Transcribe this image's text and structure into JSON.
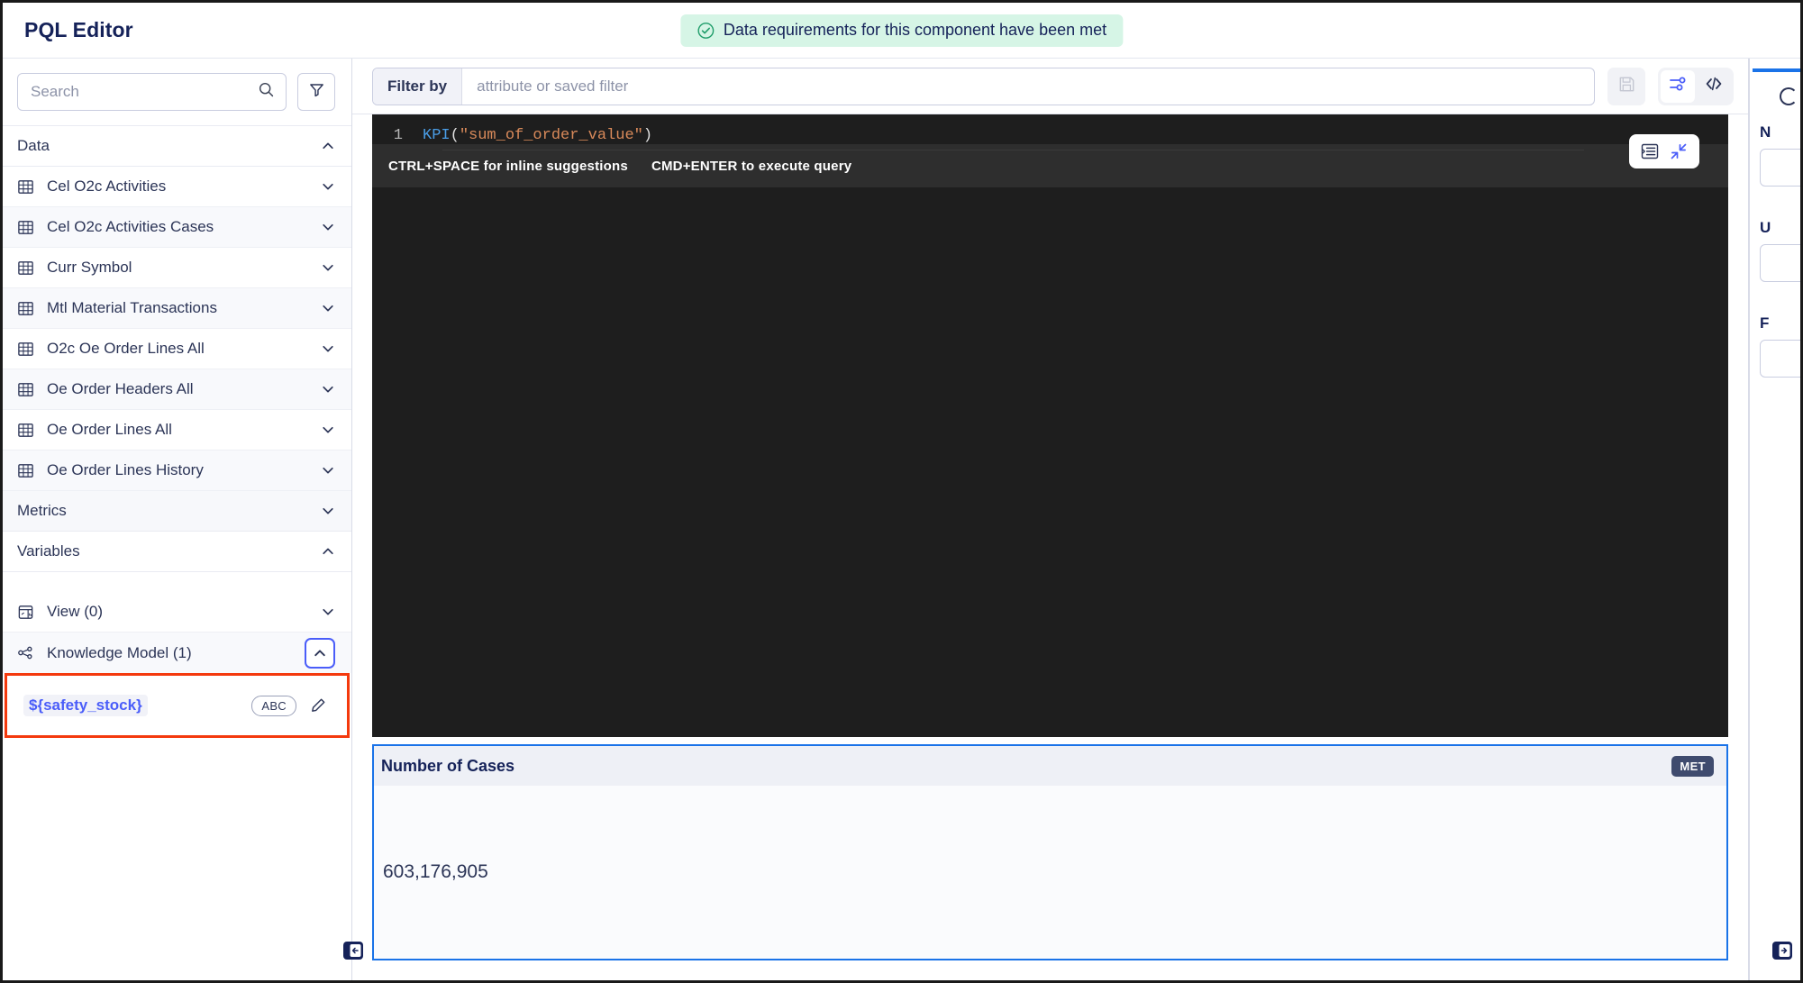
{
  "header": {
    "title": "PQL Editor",
    "banner": {
      "text": "Data requirements for this component have been met",
      "icon": "check-circle-icon",
      "bg_color": "#d6f5e6",
      "icon_color": "#1f9d6a"
    }
  },
  "sidebar": {
    "search": {
      "value": "",
      "placeholder": "Search",
      "icon": "search-icon"
    },
    "filter_button": {
      "icon": "funnel-icon"
    },
    "groups": [
      {
        "label": "Data",
        "expanded": true,
        "chevron": "chevron-up-icon"
      },
      {
        "label": "Metrics",
        "expanded": false,
        "chevron": "chevron-down-icon"
      },
      {
        "label": "Variables",
        "expanded": true,
        "chevron": "chevron-up-icon"
      }
    ],
    "tables": [
      {
        "label": "Cel O2c Activities",
        "icon": "table-icon",
        "chevron": "chevron-down-icon"
      },
      {
        "label": "Cel O2c Activities Cases",
        "icon": "table-icon",
        "chevron": "chevron-down-icon"
      },
      {
        "label": "Curr Symbol",
        "icon": "table-icon",
        "chevron": "chevron-down-icon"
      },
      {
        "label": "Mtl Material Transactions",
        "icon": "table-icon",
        "chevron": "chevron-down-icon"
      },
      {
        "label": "O2c Oe Order Lines All",
        "icon": "table-icon",
        "chevron": "chevron-down-icon"
      },
      {
        "label": "Oe Order Headers All",
        "icon": "table-icon",
        "chevron": "chevron-down-icon"
      },
      {
        "label": "Oe Order Lines All",
        "icon": "table-icon",
        "chevron": "chevron-down-icon"
      },
      {
        "label": "Oe Order Lines History",
        "icon": "table-icon",
        "chevron": "chevron-down-icon"
      }
    ],
    "variable_sources": [
      {
        "label": "View (0)",
        "icon": "view-variable-icon",
        "chevron": "chevron-down-icon",
        "expanded": false
      },
      {
        "label": "Knowledge Model (1)",
        "icon": "knowledge-model-icon",
        "chevron": "chevron-up-icon",
        "expanded": true
      }
    ],
    "variables": [
      {
        "name": "${safety_stock}",
        "type_badge": "ABC",
        "edit_icon": "pencil-icon"
      }
    ],
    "highlight_color": "#f4390d",
    "focus_color": "#4a5df9",
    "collapse_button": {
      "icon": "collapse-left-panel-icon"
    }
  },
  "filter_bar": {
    "label": "Filter by",
    "input_value": "",
    "input_placeholder": "attribute or saved filter",
    "save_button": {
      "icon": "save-disk-icon",
      "disabled": true
    },
    "view_toggle": [
      {
        "icon": "sliders-icon",
        "active": true
      },
      {
        "icon": "code-brackets-icon",
        "active": false
      }
    ]
  },
  "editor": {
    "line_number": "1",
    "code": {
      "function": "KPI",
      "open_paren": "(",
      "string": "\"sum_of_order_value\"",
      "close_paren": ")"
    },
    "full_text": "KPI(\"sum_of_order_value\")",
    "background": "#1e1e1e",
    "tools": [
      {
        "icon": "format-code-icon"
      },
      {
        "icon": "collapse-arrows-icon"
      }
    ],
    "hints": [
      "CTRL+SPACE for inline suggestions",
      "CMD+ENTER to execute query"
    ]
  },
  "result": {
    "title": "Number of Cases",
    "badge": "MET",
    "value": "603,176,905",
    "border_color": "#1a73e8"
  },
  "right_rail": {
    "labels": [
      "N",
      "U",
      "F"
    ],
    "collapse_button": {
      "icon": "expand-right-panel-icon"
    }
  }
}
